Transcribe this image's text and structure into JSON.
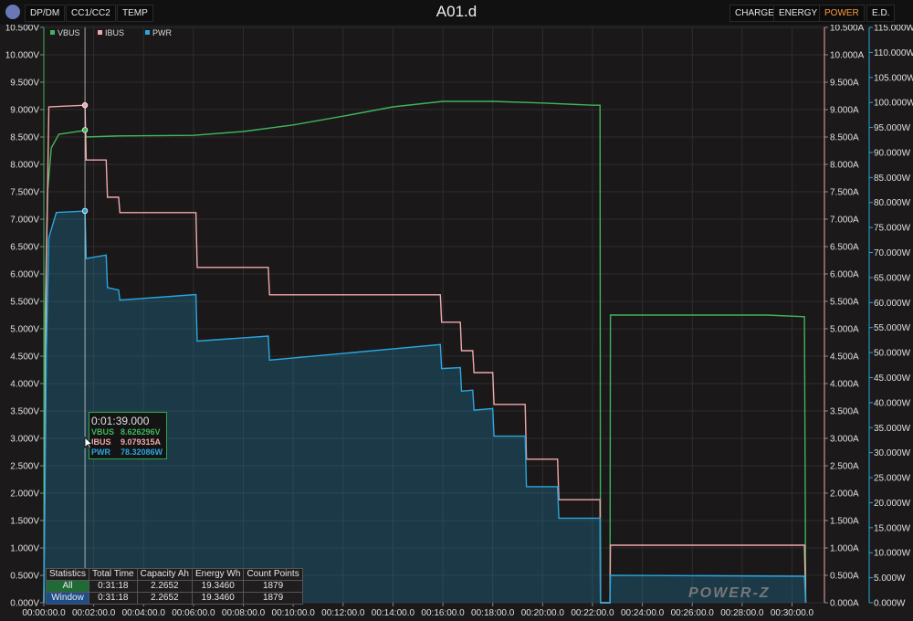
{
  "app": {
    "title": "A01.d"
  },
  "toolbar": {
    "left": [
      "DP/DM",
      "CC1/CC2",
      "TEMP"
    ],
    "right": [
      "CHARGE",
      "ENERGY",
      "POWER",
      "E.D."
    ],
    "active": "POWER"
  },
  "legend": [
    {
      "name": "VBUS",
      "color": "#3fb55c"
    },
    {
      "name": "IBUS",
      "color": "#f0a8ac"
    },
    {
      "name": "PWR",
      "color": "#2aa7e0"
    }
  ],
  "axes": {
    "left_ticks": [
      "0.000V",
      "0.500V",
      "1.000V",
      "1.500V",
      "2.000V",
      "2.500V",
      "3.000V",
      "3.500V",
      "4.000V",
      "4.500V",
      "5.000V",
      "5.500V",
      "6.000V",
      "6.500V",
      "7.000V",
      "7.500V",
      "8.000V",
      "8.500V",
      "9.000V",
      "9.500V",
      "10.000V",
      "10.500V"
    ],
    "right1_ticks": [
      "0.000A",
      "0.500A",
      "1.000A",
      "1.500A",
      "2.000A",
      "2.500A",
      "3.000A",
      "3.500A",
      "4.000A",
      "4.500A",
      "5.000A",
      "5.500A",
      "6.000A",
      "6.500A",
      "7.000A",
      "7.500A",
      "8.000A",
      "8.500A",
      "9.000A",
      "9.500A",
      "10.000A",
      "10.500A"
    ],
    "right2_ticks": [
      "0.000W",
      "5.000W",
      "10.000W",
      "15.000W",
      "20.000W",
      "25.000W",
      "30.000W",
      "35.000W",
      "40.000W",
      "45.000W",
      "50.000W",
      "55.000W",
      "60.000W",
      "65.000W",
      "70.000W",
      "75.000W",
      "80.000W",
      "85.000W",
      "90.000W",
      "95.000W",
      "100.000W",
      "105.000W",
      "110.000W",
      "115.000W"
    ],
    "x_ticks": [
      "00:00:00.0",
      "00:02:00.0",
      "00:04:00.0",
      "00:06:00.0",
      "00:08:00.0",
      "00:10:00.0",
      "00:12:00.0",
      "00:14:00.0",
      "00:16:00.0",
      "00:18:00.0",
      "00:20:00.0",
      "00:22:00.0",
      "00:24:00.0",
      "00:26:00.0",
      "00:28:00.0",
      "00:30:00.0"
    ]
  },
  "chart_data": {
    "type": "line",
    "x_unit": "min",
    "xlim": [
      0,
      31.3
    ],
    "series": [
      {
        "name": "VBUS",
        "unit": "V",
        "color": "#3fb55c",
        "axis": "left",
        "points": [
          [
            0,
            0
          ],
          [
            0.05,
            5.3
          ],
          [
            0.15,
            7.5
          ],
          [
            0.3,
            8.3
          ],
          [
            0.6,
            8.55
          ],
          [
            1.65,
            8.62
          ],
          [
            1.7,
            8.5
          ],
          [
            3,
            8.52
          ],
          [
            6,
            8.53
          ],
          [
            8,
            8.6
          ],
          [
            10,
            8.72
          ],
          [
            12,
            8.88
          ],
          [
            14,
            9.05
          ],
          [
            16,
            9.15
          ],
          [
            18,
            9.15
          ],
          [
            20,
            9.12
          ],
          [
            22,
            9.08
          ],
          [
            22.3,
            9.08
          ],
          [
            22.32,
            0
          ],
          [
            22.7,
            0
          ],
          [
            22.72,
            5.25
          ],
          [
            29,
            5.25
          ],
          [
            30.5,
            5.22
          ],
          [
            30.55,
            0
          ]
        ]
      },
      {
        "name": "IBUS",
        "unit": "A",
        "color": "#f0a8ac",
        "axis": "right",
        "points": [
          [
            0,
            0
          ],
          [
            0.1,
            6.0
          ],
          [
            0.2,
            9.05
          ],
          [
            1.65,
            9.08
          ],
          [
            1.7,
            8.08
          ],
          [
            2.5,
            8.08
          ],
          [
            2.55,
            7.4
          ],
          [
            3,
            7.4
          ],
          [
            3.05,
            7.12
          ],
          [
            6.1,
            7.12
          ],
          [
            6.15,
            6.12
          ],
          [
            9.0,
            6.12
          ],
          [
            9.05,
            5.62
          ],
          [
            15.9,
            5.62
          ],
          [
            15.95,
            5.12
          ],
          [
            16.7,
            5.12
          ],
          [
            16.75,
            4.6
          ],
          [
            17.2,
            4.6
          ],
          [
            17.25,
            4.2
          ],
          [
            18,
            4.2
          ],
          [
            18.05,
            3.62
          ],
          [
            19.3,
            3.62
          ],
          [
            19.35,
            2.62
          ],
          [
            20.6,
            2.62
          ],
          [
            20.65,
            1.88
          ],
          [
            22.3,
            1.88
          ],
          [
            22.32,
            0
          ],
          [
            22.7,
            0
          ],
          [
            22.72,
            1.05
          ],
          [
            30.5,
            1.05
          ],
          [
            30.55,
            0
          ]
        ]
      },
      {
        "name": "PWR",
        "unit": "W",
        "color": "#2aa7e0",
        "axis": "right2",
        "points": [
          [
            0,
            0
          ],
          [
            0.1,
            50
          ],
          [
            0.2,
            73
          ],
          [
            0.5,
            78
          ],
          [
            1.65,
            78.3
          ],
          [
            1.7,
            68.8
          ],
          [
            2.5,
            69.5
          ],
          [
            2.55,
            63
          ],
          [
            3,
            62.5
          ],
          [
            3.05,
            60.5
          ],
          [
            6.1,
            61.6
          ],
          [
            6.15,
            52.3
          ],
          [
            9.0,
            53.3
          ],
          [
            9.05,
            48.5
          ],
          [
            15.9,
            51.6
          ],
          [
            15.95,
            46.8
          ],
          [
            16.7,
            47
          ],
          [
            16.75,
            42.3
          ],
          [
            17.2,
            42.5
          ],
          [
            17.25,
            38.5
          ],
          [
            18,
            38.8
          ],
          [
            18.05,
            33.3
          ],
          [
            19.3,
            33.3
          ],
          [
            19.35,
            23.2
          ],
          [
            20.6,
            23.2
          ],
          [
            20.65,
            16.9
          ],
          [
            22.3,
            16.9
          ],
          [
            22.32,
            0
          ],
          [
            22.7,
            0
          ],
          [
            22.72,
            5.5
          ],
          [
            30.5,
            5.3
          ],
          [
            30.55,
            0
          ]
        ]
      }
    ]
  },
  "cursor_readout": {
    "time": "0:01:39.000",
    "rows": [
      {
        "name": "VBUS",
        "value": "8.626296V",
        "color": "#3fb55c"
      },
      {
        "name": "IBUS",
        "value": "9.079315A",
        "color": "#f0a8ac"
      },
      {
        "name": "PWR",
        "value": "78.32086W",
        "color": "#2aa7e0"
      }
    ]
  },
  "statistics": {
    "headers": [
      "Statistics",
      "Total Time",
      "Capacity Ah",
      "Energy Wh",
      "Count Points"
    ],
    "rows": [
      {
        "label": "All",
        "values": [
          "0:31:18",
          "2.2652",
          "19.3460",
          "1879"
        ]
      },
      {
        "label": "Window",
        "values": [
          "0:31:18",
          "2.2652",
          "19.3460",
          "1879"
        ]
      }
    ]
  },
  "watermark": "POWER-Z"
}
